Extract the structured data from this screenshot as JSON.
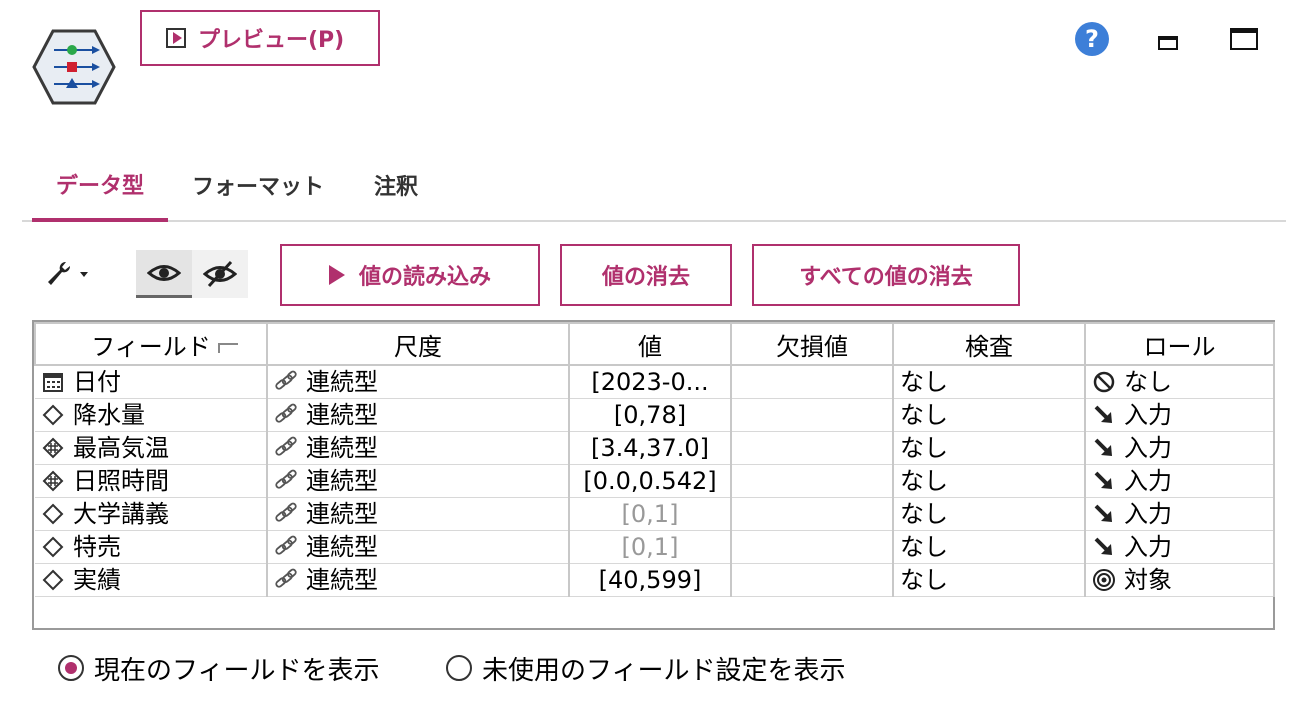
{
  "header": {
    "preview_label": "プレビュー(P)",
    "help_symbol": "?"
  },
  "tabs": [
    {
      "label": "データ型",
      "active": true
    },
    {
      "label": "フォーマット",
      "active": false
    },
    {
      "label": "注釈",
      "active": false
    }
  ],
  "toolbar": {
    "read_values_label": "値の読み込み",
    "clear_values_label": "値の消去",
    "clear_all_values_label": "すべての値の消去"
  },
  "table": {
    "columns": [
      "フィールド",
      "尺度",
      "値",
      "欠損値",
      "検査",
      "ロール"
    ],
    "rows": [
      {
        "field": "日付",
        "field_icon": "calendar-icon",
        "measure": "連続型",
        "value": "[2023-0...",
        "value_gray": false,
        "missing": "",
        "check": "なし",
        "role": "なし",
        "role_icon": "no-role-icon"
      },
      {
        "field": "降水量",
        "field_icon": "diamond-icon",
        "measure": "連続型",
        "value": "[0,78]",
        "value_gray": false,
        "missing": "",
        "check": "なし",
        "role": "入力",
        "role_icon": "input-arrow-icon"
      },
      {
        "field": "最高気温",
        "field_icon": "diamond-hash-icon",
        "measure": "連続型",
        "value": "[3.4,37.0]",
        "value_gray": false,
        "missing": "",
        "check": "なし",
        "role": "入力",
        "role_icon": "input-arrow-icon"
      },
      {
        "field": "日照時間",
        "field_icon": "diamond-hash-icon",
        "measure": "連続型",
        "value": "[0.0,0.542]",
        "value_gray": false,
        "missing": "",
        "check": "なし",
        "role": "入力",
        "role_icon": "input-arrow-icon"
      },
      {
        "field": "大学講義",
        "field_icon": "diamond-icon",
        "measure": "連続型",
        "value": "[0,1]",
        "value_gray": true,
        "missing": "",
        "check": "なし",
        "role": "入力",
        "role_icon": "input-arrow-icon"
      },
      {
        "field": "特売",
        "field_icon": "diamond-icon",
        "measure": "連続型",
        "value": "[0,1]",
        "value_gray": true,
        "missing": "",
        "check": "なし",
        "role": "入力",
        "role_icon": "input-arrow-icon"
      },
      {
        "field": "実績",
        "field_icon": "diamond-icon",
        "measure": "連続型",
        "value": "[40,599]",
        "value_gray": false,
        "missing": "",
        "check": "なし",
        "role": "対象",
        "role_icon": "target-icon"
      }
    ]
  },
  "view_options": [
    {
      "label": "現在のフィールドを表示",
      "selected": true
    },
    {
      "label": "未使用のフィールド設定を表示",
      "selected": false
    }
  ],
  "colors": {
    "accent": "#b0306d",
    "help_blue": "#3d7fd8"
  }
}
